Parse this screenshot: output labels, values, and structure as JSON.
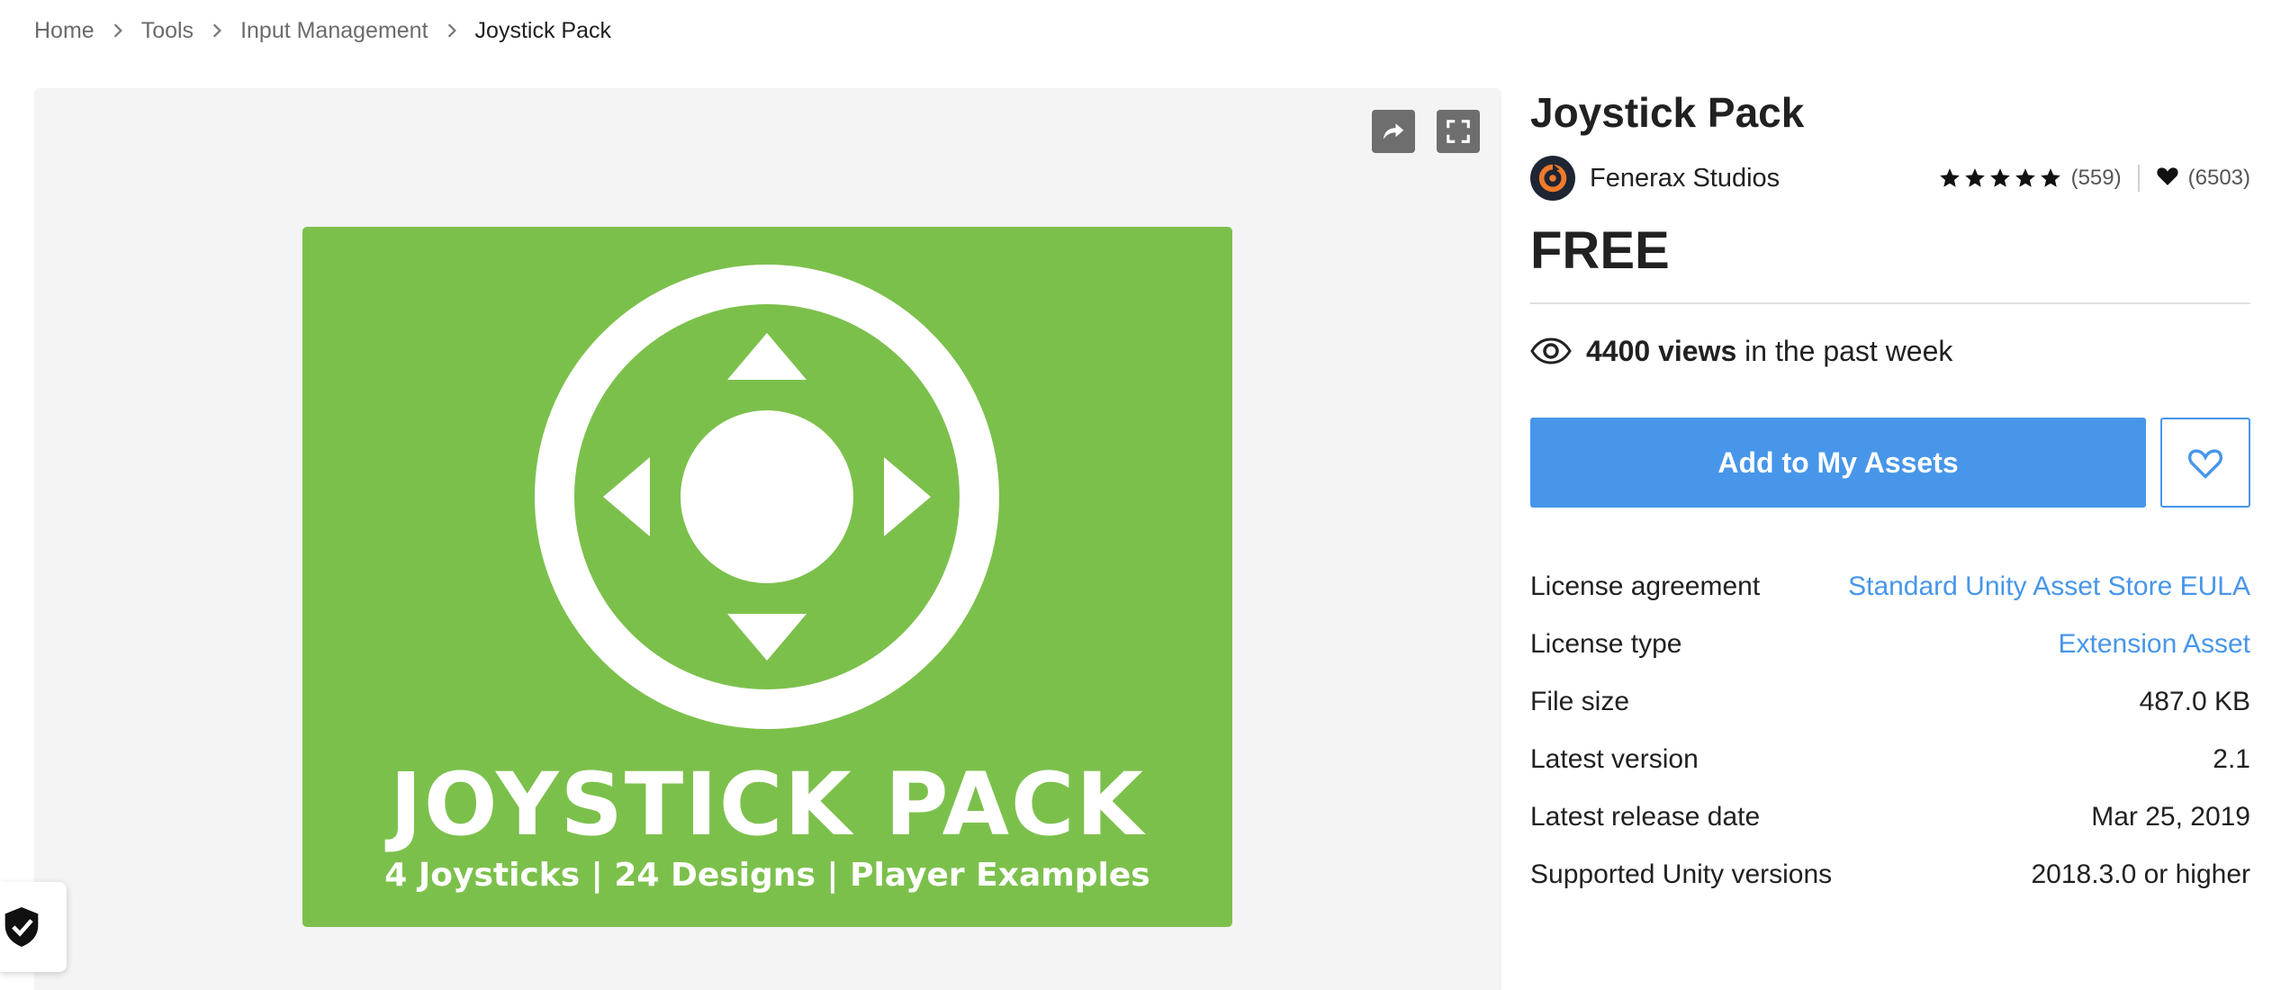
{
  "breadcrumb": {
    "items": [
      "Home",
      "Tools",
      "Input Management",
      "Joystick Pack"
    ]
  },
  "gallery": {
    "hero_title": "JOYSTICK PACK",
    "hero_subtitle": "4 Joysticks | 24 Designs | Player Examples",
    "hero_color": "#7cc04c",
    "share_icon": "share-icon",
    "fullscreen_icon": "fullscreen-icon"
  },
  "product": {
    "title": "Joystick Pack",
    "publisher": "Fenerax Studios",
    "rating_stars": 5,
    "rating_count": "(559)",
    "favorites_count": "(6503)",
    "price": "FREE",
    "views_count": "4400 views",
    "views_suffix": " in the past week",
    "add_button_label": "Add to My Assets",
    "accent_color": "#4796ea"
  },
  "details": [
    {
      "label": "License agreement",
      "value": "Standard Unity Asset Store EULA",
      "link": true
    },
    {
      "label": "License type",
      "value": "Extension Asset",
      "link": true
    },
    {
      "label": "File size",
      "value": "487.0 KB",
      "link": false
    },
    {
      "label": "Latest version",
      "value": "2.1",
      "link": false
    },
    {
      "label": "Latest release date",
      "value": "Mar 25, 2019",
      "link": false
    },
    {
      "label": "Supported Unity versions",
      "value": "2018.3.0 or higher",
      "link": false
    }
  ]
}
